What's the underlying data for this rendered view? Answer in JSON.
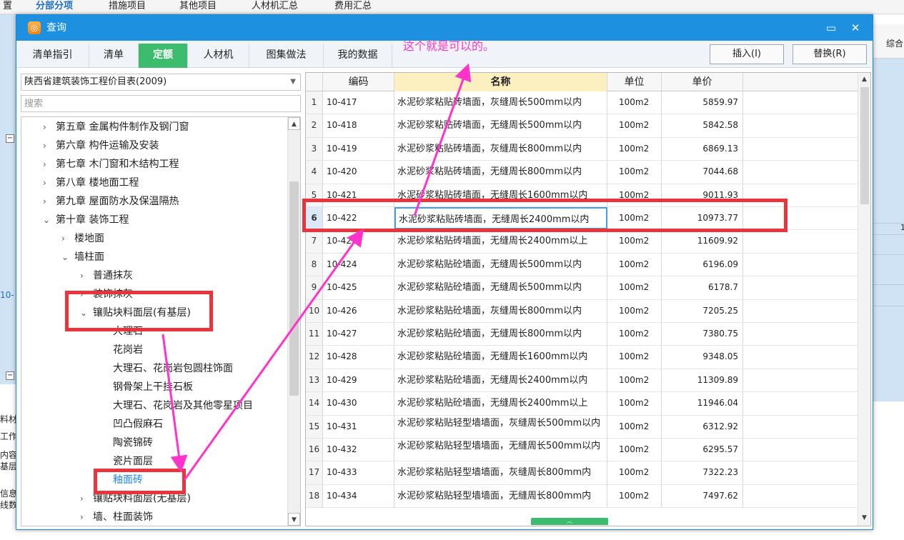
{
  "background": {
    "tabs": [
      "置",
      "分部分项",
      "措施项目",
      "其他项目",
      "人材机汇总",
      "费用汇总"
    ],
    "active_tab": "分部分项",
    "right_header": "综合",
    "left_labels": [
      "10-",
      "料材",
      "工作",
      "内容",
      "基层",
      "信息",
      "线数"
    ],
    "right_value": "1"
  },
  "dialog": {
    "title": "查询",
    "title_icon": "query-icon",
    "minimize_glyph": "▭",
    "close_glyph": "✕",
    "tabs": [
      "清单指引",
      "清单",
      "定额",
      "人材机",
      "图集做法",
      "我的数据"
    ],
    "active_tab": "定额",
    "insert_button": "插入(I)",
    "replace_button": "替换(R)",
    "note": "这个就是可以的。",
    "library": "陕西省建筑装饰工程价目表(2009)",
    "search_placeholder": "搜索",
    "tree": [
      {
        "label": "第五章 金属构件制作及钢门窗",
        "chev": "›"
      },
      {
        "label": "第六章 构件运输及安装",
        "chev": "›"
      },
      {
        "label": "第七章 木门窗和木结构工程",
        "chev": "›"
      },
      {
        "label": "第八章 楼地面工程",
        "chev": "›"
      },
      {
        "label": "第九章 屋面防水及保温隔热",
        "chev": "›"
      },
      {
        "label": "第十章 装饰工程",
        "chev": "⌄"
      },
      {
        "label": "楼地面",
        "chev": "›"
      },
      {
        "label": "墙柱面",
        "chev": "⌄"
      },
      {
        "label": "普通抹灰",
        "chev": "›"
      },
      {
        "label": "装饰抹灰",
        "chev": "›"
      },
      {
        "label": "镶贴块料面层(有基层)",
        "chev": "⌄"
      },
      {
        "label": "大理石",
        "chev": ""
      },
      {
        "label": "花岗岩",
        "chev": ""
      },
      {
        "label": "大理石、花岗岩包圆柱饰面",
        "chev": ""
      },
      {
        "label": "钢骨架上干挂石板",
        "chev": ""
      },
      {
        "label": "大理石、花岗岩及其他零星项目",
        "chev": ""
      },
      {
        "label": "凹凸假麻石",
        "chev": ""
      },
      {
        "label": "陶瓷锦砖",
        "chev": ""
      },
      {
        "label": "瓷片面层",
        "chev": ""
      },
      {
        "label": "釉面砖",
        "chev": ""
      },
      {
        "label": "镶贴块料面层(无基层)",
        "chev": "›"
      },
      {
        "label": "墙、柱面装饰",
        "chev": "›"
      }
    ],
    "selected_tree_item": "釉面砖",
    "columns": {
      "code": "编码",
      "name": "名称",
      "unit": "单位",
      "price": "单价"
    },
    "rows": [
      {
        "idx": "1",
        "code": "10-417",
        "name": "水泥砂浆粘贴砖墙面，灰缝周长500mm以内",
        "unit": "100m2",
        "price": "5859.97"
      },
      {
        "idx": "2",
        "code": "10-418",
        "name": "水泥砂浆粘贴砖墙面，无缝周长500mm以内",
        "unit": "100m2",
        "price": "5842.58"
      },
      {
        "idx": "3",
        "code": "10-419",
        "name": "水泥砂浆粘贴砖墙面，灰缝周长800mm以内",
        "unit": "100m2",
        "price": "6869.13"
      },
      {
        "idx": "4",
        "code": "10-420",
        "name": "水泥砂浆粘贴砖墙面，无缝周长800mm以内",
        "unit": "100m2",
        "price": "7044.68"
      },
      {
        "idx": "5",
        "code": "10-421",
        "name": "水泥砂浆粘贴砖墙面，无缝周长1600mm以内",
        "unit": "100m2",
        "price": "9011.93"
      },
      {
        "idx": "6",
        "code": "10-422",
        "name": "水泥砂浆粘贴砖墙面，无缝周长2400mm以内",
        "unit": "100m2",
        "price": "10973.77"
      },
      {
        "idx": "7",
        "code": "10-423",
        "name": "水泥砂浆粘贴砖墙面，无缝周长2400mm以上",
        "unit": "100m2",
        "price": "11609.92"
      },
      {
        "idx": "8",
        "code": "10-424",
        "name": "水泥砂浆粘贴砼墙面，无缝周长500mm以内",
        "unit": "100m2",
        "price": "6196.09"
      },
      {
        "idx": "9",
        "code": "10-425",
        "name": "水泥砂浆粘贴砼墙面，无缝周长500mm以内",
        "unit": "100m2",
        "price": "6178.7"
      },
      {
        "idx": "10",
        "code": "10-426",
        "name": "水泥砂浆粘贴砼墙面，灰缝周长800mm以内",
        "unit": "100m2",
        "price": "7205.25"
      },
      {
        "idx": "11",
        "code": "10-427",
        "name": "水泥砂浆粘贴砼墙面，无缝周长800mm以内",
        "unit": "100m2",
        "price": "7380.75"
      },
      {
        "idx": "12",
        "code": "10-428",
        "name": "水泥砂浆粘贴砼墙面，无缝周长1600mm以内",
        "unit": "100m2",
        "price": "9348.05"
      },
      {
        "idx": "13",
        "code": "10-429",
        "name": "水泥砂浆粘贴砼墙面，无缝周长2400mm以内",
        "unit": "100m2",
        "price": "11309.89"
      },
      {
        "idx": "14",
        "code": "10-430",
        "name": "水泥砂浆粘贴砼墙面，无缝周长2400mm以上",
        "unit": "100m2",
        "price": "11946.04"
      },
      {
        "idx": "15",
        "code": "10-431",
        "name": "水泥砂浆粘贴轻型墙墙面，灰缝周长500mm以内",
        "unit": "100m2",
        "price": "6312.92"
      },
      {
        "idx": "16",
        "code": "10-432",
        "name": "水泥砂浆粘贴轻型墙墙面，无缝周长500mm以内",
        "unit": "100m2",
        "price": "6295.57"
      },
      {
        "idx": "17",
        "code": "10-433",
        "name": "水泥砂浆粘贴轻型墙墙面，灰缝周长800mm内",
        "unit": "100m2",
        "price": "7322.23"
      },
      {
        "idx": "18",
        "code": "10-434",
        "name": "水泥砂浆粘贴轻型墙墙面，无缝周长800mm内",
        "unit": "100m2",
        "price": "7497.62"
      }
    ],
    "current_row": "6"
  },
  "colors": {
    "title_bar": "#1e90e0",
    "active_tab": "#3cbc6c",
    "annotation_arrow": "#ff33cc",
    "annotation_box": "#e8343a",
    "name_header": "#fcefc0"
  }
}
